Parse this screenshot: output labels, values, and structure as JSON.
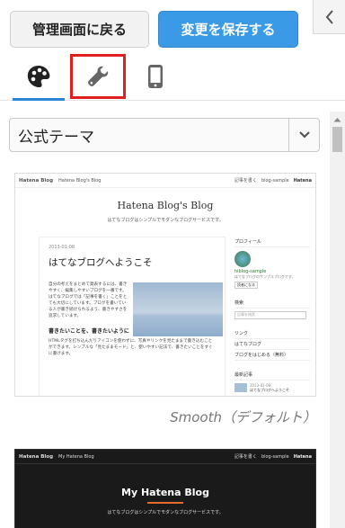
{
  "toolbar": {
    "back_label": "管理画面に戻る",
    "save_label": "変更を保存する"
  },
  "tabs": [
    {
      "icon": "palette-icon",
      "active": true
    },
    {
      "icon": "wrench-icon",
      "active": false
    },
    {
      "icon": "smartphone-icon",
      "active": false
    }
  ],
  "theme_select": {
    "selected": "公式テーマ"
  },
  "themes": [
    {
      "name": "Smooth（デフォルト）",
      "preview": {
        "logo": "Hatena Blog",
        "blog_header_name": "Hatena Blog's Blog",
        "header_links": "記事を書く",
        "blog_menu": "blog-sample",
        "brand": "Hatena",
        "blog_title": "Hatena Blog's Blog",
        "blog_description": "はてなブログはシンプルでモダンなブログサービスです。",
        "entry_date": "2013-01-08",
        "entry_title": "はてなブログへようこそ",
        "entry_text": "自分の考えをまとめて発表するには、書きやすく、編集しやすいブログを一番です。はてなブログでは「記事を書く」ことをとても大切にしています。ブログを書いている人が書き続けられるよう、書きやすさを追求しています。",
        "entry_h2": "書きたいことを、書きたいように",
        "entry_text2": "HTMLタグを打ち込んだりアイコンを使わずに、写真やリンクを見たままで書き込むことができます。シンプルな「見たままモード」と、使いやすい記法で、書きたいことをすぐに書けます。",
        "side_profile": "プロフィール",
        "side_user": "hiblog-sample",
        "side_user_desc": "はてなブログのサンプルブログです。",
        "side_reader": "読者になる",
        "side_search_heading": "検索",
        "side_search_placeholder": "記事を検索",
        "side_links_heading": "リンク",
        "side_links": [
          "はてなブログ",
          "ブログをはじめる（無料）"
        ],
        "side_recent_heading": "最新記事",
        "side_recent_date": "2013-01-08",
        "side_recent_title": "はてなブログへようこそ"
      }
    },
    {
      "name": "",
      "preview": {
        "logo": "Hatena Blog",
        "blog_header_name": "My Hatena Blog",
        "header_links": "記事を書く",
        "blog_menu": "blog-sample",
        "brand": "Hatena",
        "blog_title": "My Hatena Blog",
        "blog_description": "はてなブログはシンプルでモダンなブログサービスです。"
      }
    }
  ]
}
